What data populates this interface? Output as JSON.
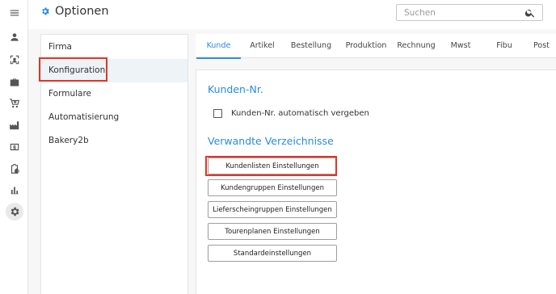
{
  "header": {
    "title": "Optionen",
    "search_placeholder": "Suchen"
  },
  "rail": {
    "icons": [
      "menu-icon",
      "person-icon",
      "scan-icon",
      "briefcase-icon",
      "cart-icon",
      "factory-icon",
      "invoice-icon",
      "clipboard-clock-icon",
      "bar-chart-icon",
      "gear-icon"
    ],
    "active": "gear-icon"
  },
  "menu": {
    "items": [
      {
        "label": "Firma"
      },
      {
        "label": "Konfiguration"
      },
      {
        "label": "Formulare"
      },
      {
        "label": "Automatisierung"
      },
      {
        "label": "Bakery2b"
      }
    ],
    "active": "Konfiguration"
  },
  "tabs": [
    {
      "label": "Kunde"
    },
    {
      "label": "Artikel"
    },
    {
      "label": "Bestellung"
    },
    {
      "label": "Produktion"
    },
    {
      "label": "Rechnung"
    },
    {
      "label": "Mwst"
    },
    {
      "label": "Fibu"
    },
    {
      "label": "Post"
    }
  ],
  "active_tab": "Kunde",
  "panel": {
    "section1_title": "Kunden-Nr.",
    "checkbox_label": "Kunden-Nr. automatisch vergeben",
    "checkbox_checked": false,
    "section2_title": "Verwandte Verzeichnisse",
    "buttons": [
      {
        "label": "Kundenlisten Einstellungen"
      },
      {
        "label": "Kundengruppen Einstellungen"
      },
      {
        "label": "Lieferscheingruppen Einstellungen"
      },
      {
        "label": "Tourenplanen Einstellungen"
      },
      {
        "label": "Standardeinstellungen"
      }
    ]
  },
  "colors": {
    "accent": "#2a8be0",
    "highlight": "#e53425",
    "active_menu_bg": "#eef3f8"
  }
}
